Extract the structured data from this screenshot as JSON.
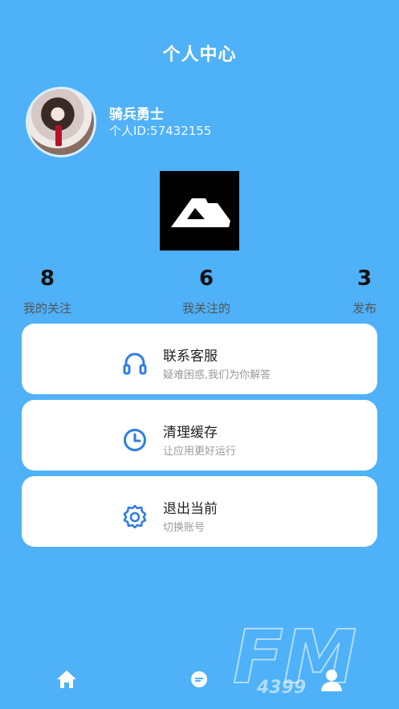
{
  "header": {
    "title": "个人中心"
  },
  "profile": {
    "name": "骑兵勇士",
    "id_text": "个人ID:57432155"
  },
  "stats": [
    {
      "value": "8",
      "label": "我的关注"
    },
    {
      "value": "6",
      "label": "我关注的"
    },
    {
      "value": "3",
      "label": "发布"
    }
  ],
  "menu": [
    {
      "title": "联系客服",
      "subtitle": "疑难困惑,我们为你解答",
      "icon": "headset-icon"
    },
    {
      "title": "清理缓存",
      "subtitle": "让应用更好运行",
      "icon": "clock-icon"
    },
    {
      "title": "退出当前",
      "subtitle": "切换账号",
      "icon": "settings-gear-icon"
    }
  ],
  "tabbar": {
    "items": [
      "home-icon",
      "chat-icon",
      "profile-icon"
    ]
  },
  "watermark": {
    "text": "FM",
    "sub": "4399"
  },
  "colors": {
    "background": "#4fb1f7",
    "accent": "#2f7de8",
    "card": "#ffffff"
  }
}
